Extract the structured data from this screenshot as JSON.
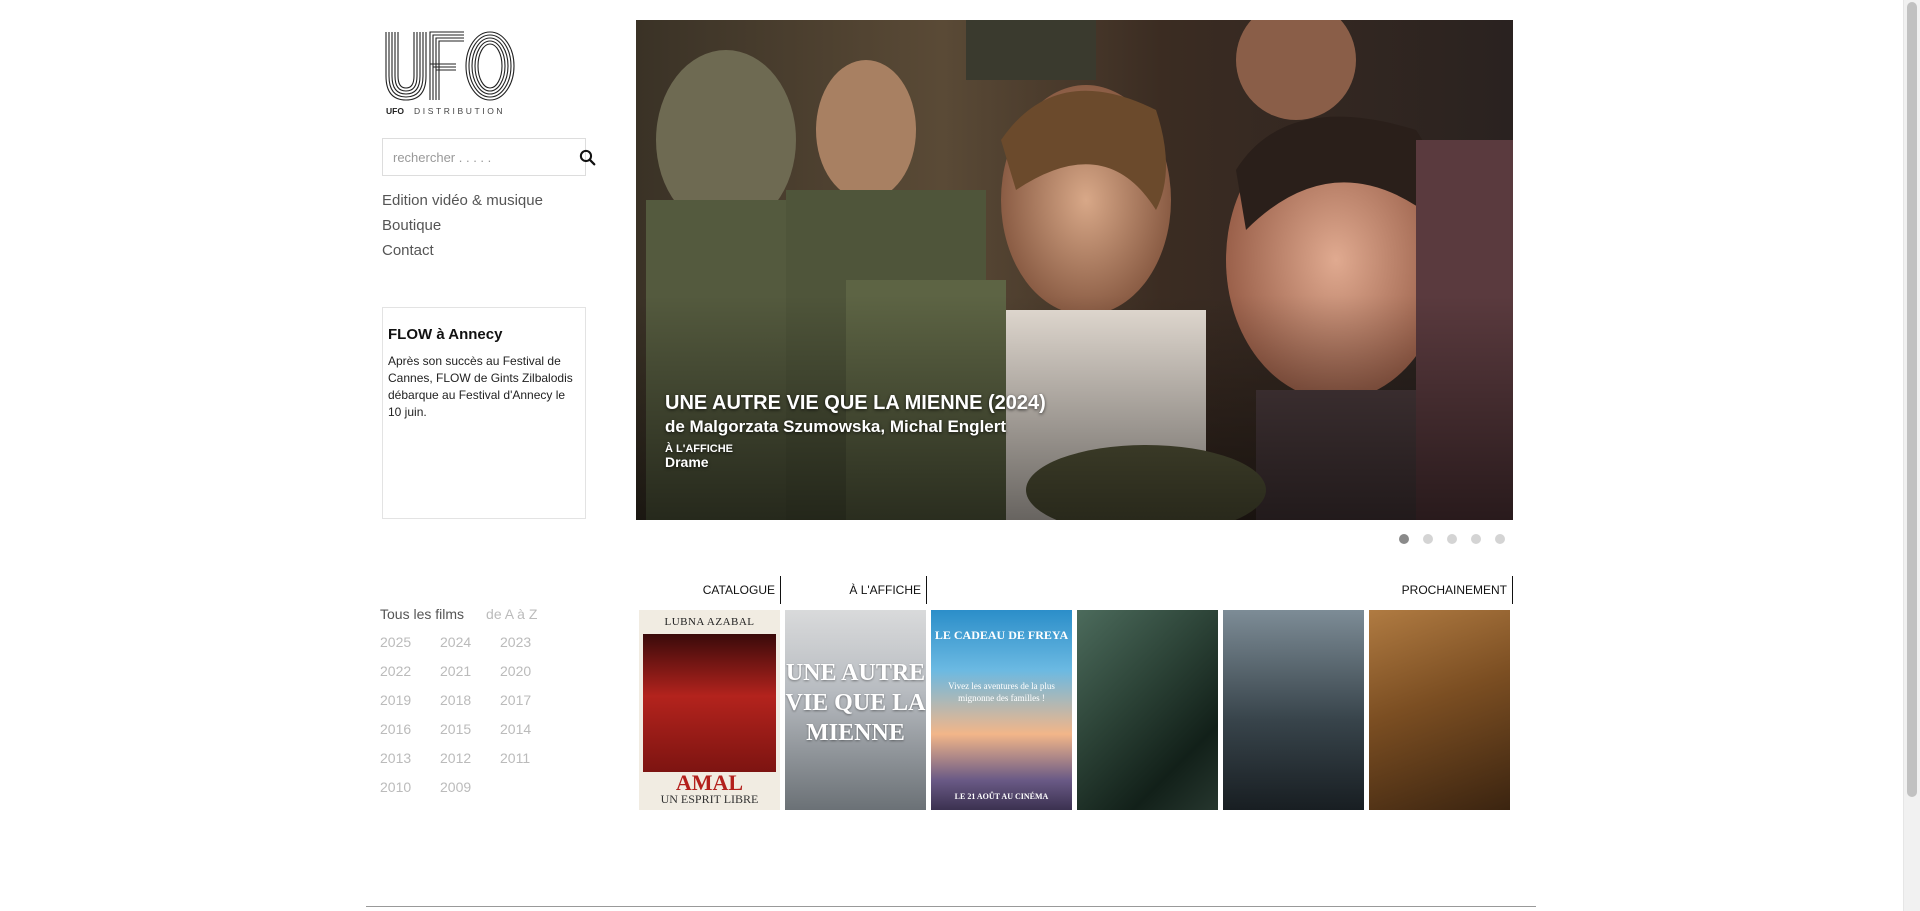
{
  "brand": {
    "logo_letters": "UFO",
    "logo_sub_bold": "UFO",
    "logo_sub": "DISTRIBUTION"
  },
  "search": {
    "placeholder": "rechercher . . . . .",
    "icon": "search-icon"
  },
  "nav": {
    "items": [
      {
        "label": "Edition vidéo & musique"
      },
      {
        "label": "Boutique"
      },
      {
        "label": "Contact"
      }
    ]
  },
  "news": {
    "title": "FLOW à Annecy",
    "text": "Après son succès au Festival de Cannes, FLOW de Gints Zilbalodis débarque au Festival d'Annecy le 10 juin."
  },
  "filters": {
    "all_label": "Tous les films",
    "az_label": "de A à Z",
    "years": [
      "2025",
      "2024",
      "2023",
      "2022",
      "2021",
      "2020",
      "2019",
      "2018",
      "2017",
      "2016",
      "2015",
      "2014",
      "2013",
      "2012",
      "2011",
      "2010",
      "2009"
    ]
  },
  "hero": {
    "title": "UNE AUTRE VIE QUE LA MIENNE (2024)",
    "director": "de Malgorzata Szumowska, Michal Englert",
    "status": "À L'AFFICHE",
    "genre": "Drame",
    "slide_count": 5,
    "active_slide": 1
  },
  "tabs": {
    "catalogue": "CATALOGUE",
    "affiche": "À L'AFFICHE",
    "prochainement": "PROCHAINEMENT"
  },
  "posters": [
    {
      "top": "LUBNA AZABAL",
      "big": "AMAL",
      "sub": "UN ESPRIT LIBRE"
    },
    {
      "big": "UNE AUTRE VIE QUE LA MIENNE"
    },
    {
      "top": "LE CADEAU DE FREYA",
      "mid": "Vivez les aventures de la plus mignonne des familles !",
      "bot": "LE 21 AOÛT AU CINÉMA"
    },
    {},
    {},
    {}
  ],
  "colors": {
    "active_dot": "#8a8a8a",
    "inactive_dot": "#d4d4d4",
    "muted_text": "#bbbbbb"
  }
}
